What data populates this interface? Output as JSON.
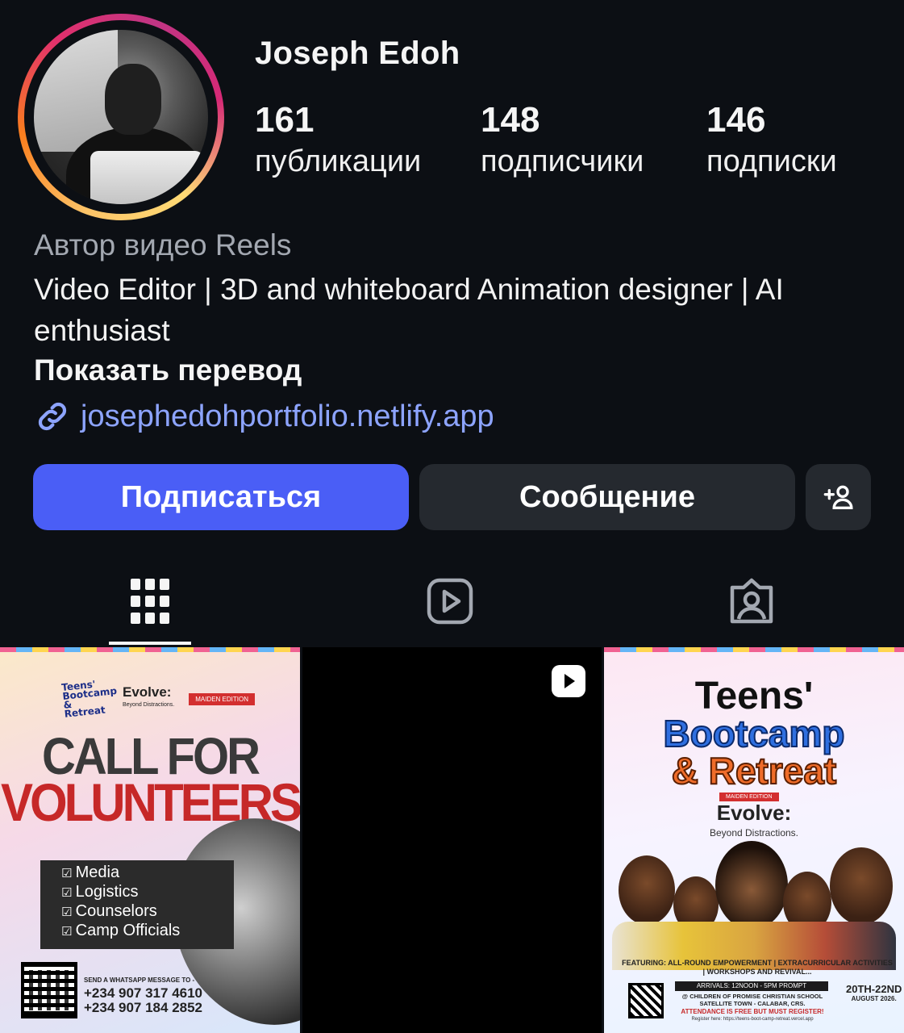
{
  "profile": {
    "username": "Joseph Edoh",
    "stats": {
      "posts": {
        "count": "161",
        "label": "публикации"
      },
      "followers": {
        "count": "148",
        "label": "подписчики"
      },
      "following": {
        "count": "146",
        "label": "подписки"
      }
    },
    "category": "Автор видео Reels",
    "bio": "Video Editor | 3D and whiteboard Animation designer | AI enthusiast",
    "translate_label": "Показать перевод",
    "link": "josephedohportfolio.netlify.app"
  },
  "actions": {
    "follow_label": "Подписаться",
    "message_label": "Сообщение",
    "add_icon": "add-person-icon"
  },
  "tabs": [
    {
      "name": "grid",
      "icon": "grid-icon",
      "active": true
    },
    {
      "name": "reels",
      "icon": "reels-icon",
      "active": false
    },
    {
      "name": "tagged",
      "icon": "tagged-icon",
      "active": false
    }
  ],
  "posts": {
    "post1": {
      "logo": "Teens' Bootcamp & Retreat",
      "brand": "Evolve:",
      "brand_sub": "Beyond Distractions.",
      "badge": "MAIDEN EDITION",
      "headline1": "CALL FOR",
      "headline2": "VOLUNTEERS",
      "roles": [
        "Media",
        "Logistics",
        "Counselors",
        "Camp Officials"
      ],
      "send_text": "SEND A WHATSAPP MESSAGE TO -",
      "phone1": "+234 907 317 4610",
      "phone2": "+234 907 184 2852"
    },
    "post2": {
      "type_icon": "reel-play-icon"
    },
    "post3": {
      "title1": "Teens'",
      "title2": "Bootcamp",
      "title3": "& Retreat",
      "maiden": "MAIDEN EDITION",
      "brand": "Evolve:",
      "brand_sub": "Beyond Distractions.",
      "featuring": "FEATURING: ALL-ROUND EMPOWERMENT | EXTRACURRICULAR ACTIVITIES | WORKSHOPS AND REVIVAL...",
      "arrivals": "ARRIVALS: 12NOON - 5PM PROMPT",
      "venue": "@ CHILDREN OF PROMISE CHRISTIAN SCHOOL SATELLITE TOWN - CALABAR, CRS.",
      "free_note": "ATTENDANCE IS FREE BUT MUST REGISTER!",
      "register": "Register here: https://teens-boot-camp-retreat.vercel.app",
      "date": "20TH-22ND",
      "month": "AUGUST 2026."
    }
  },
  "colors": {
    "background": "#0c0f14",
    "follow_button": "#4a5ef6",
    "secondary_button": "#25292f",
    "link": "#8da4ff",
    "muted_text": "#a3a8b1"
  }
}
